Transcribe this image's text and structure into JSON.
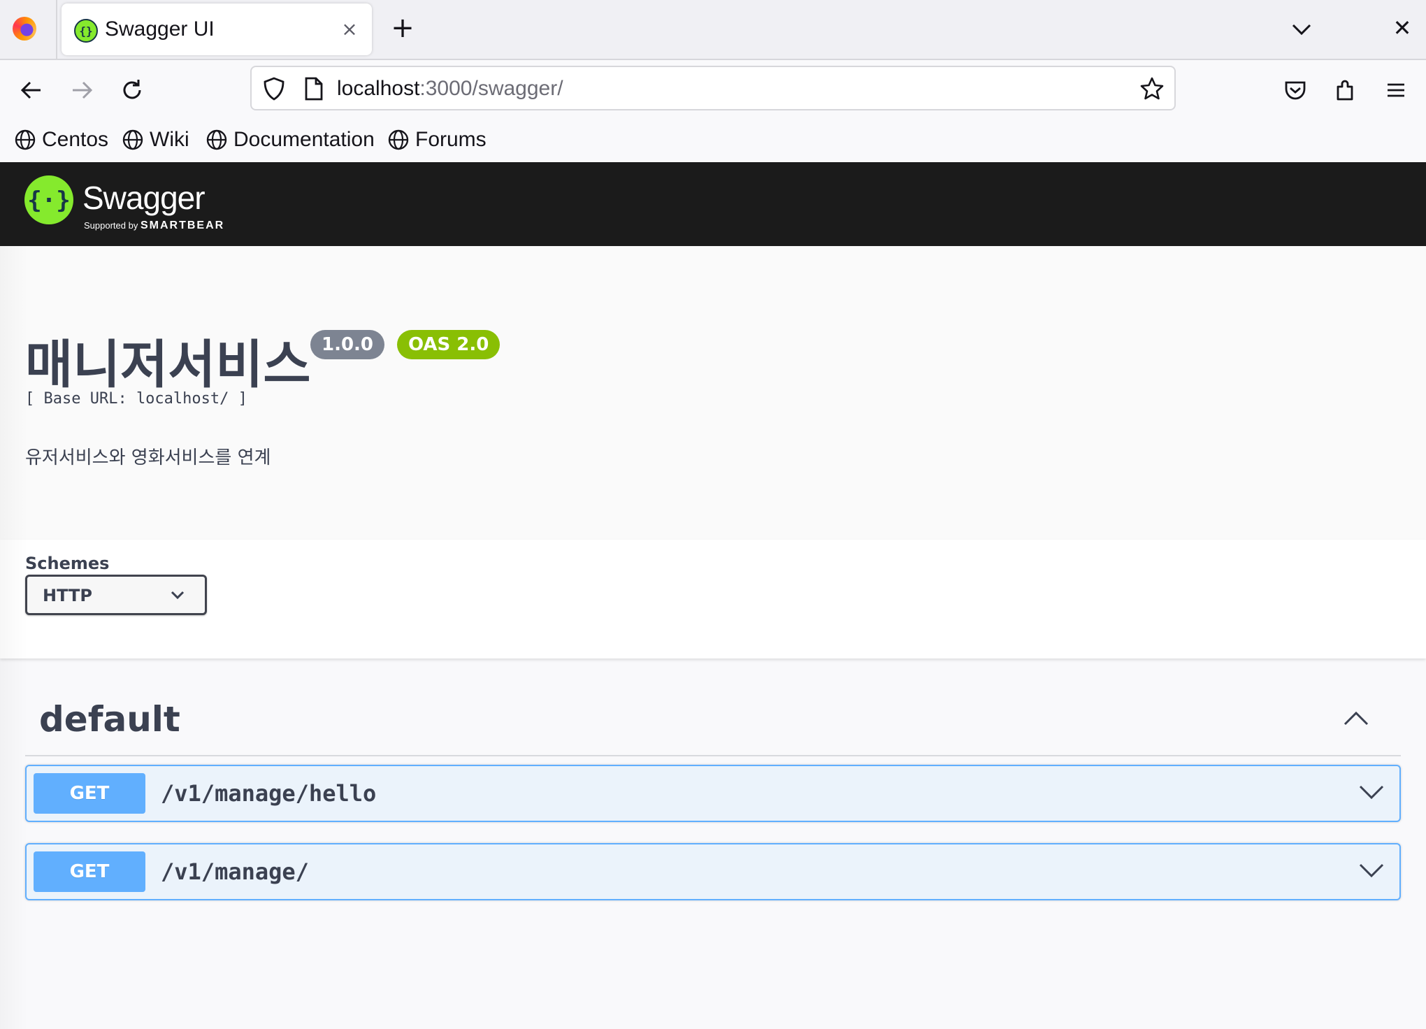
{
  "browser": {
    "tab": {
      "title": "Swagger UI",
      "close_symbol": "×",
      "favicon": "swagger-icon"
    },
    "new_tab_symbol": "+",
    "window_close_symbol": "✕",
    "address": {
      "host": "localhost",
      "rest": ":3000/swagger/"
    },
    "bookmarks": [
      {
        "label": "Centos",
        "icon": "globe-icon"
      },
      {
        "label": "Wiki",
        "icon": "globe-icon"
      },
      {
        "label": "Documentation",
        "icon": "globe-icon"
      },
      {
        "label": "Forums",
        "icon": "globe-icon"
      }
    ]
  },
  "swagger": {
    "brand": "Swagger",
    "supported_by": "Supported by",
    "company": "SMARTBEAR",
    "info": {
      "title": "매니저서비스",
      "version": "1.0.0",
      "spec": "OAS 2.0",
      "base_url": "[ Base URL: localhost/ ]",
      "description": "유저서비스와 영화서비스를 연계"
    },
    "schemes": {
      "label": "Schemes",
      "selected": "HTTP"
    },
    "tag": {
      "name": "default",
      "operations": [
        {
          "method": "GET",
          "path": "/v1/manage/hello"
        },
        {
          "method": "GET",
          "path": "/v1/manage/"
        }
      ]
    }
  },
  "colors": {
    "topbar_bg": "#1b1b1b",
    "swagger_green": "#85ea2d",
    "version_badge": "#7d8492",
    "oas_badge": "#89bf04",
    "get_blue": "#61affe",
    "get_bg": "#ebf3fb"
  }
}
